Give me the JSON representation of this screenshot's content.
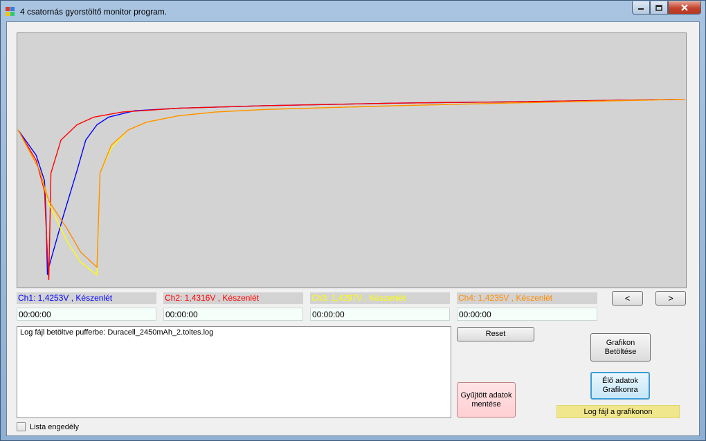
{
  "window": {
    "title": "4 csatornás gyorstöltő monitor program."
  },
  "channels": [
    {
      "label": "Ch1: 1,4253V , Készenlét",
      "time": "00:00:00",
      "color": "#0000ff"
    },
    {
      "label": "Ch2: 1,4316V , Készenlét",
      "time": "00:00:00",
      "color": "#ff0000"
    },
    {
      "label": "Ch3: 1,4297V , Készenlét",
      "time": "00:00:00",
      "color": "#ffff00"
    },
    {
      "label": "Ch4: 1,4235V , Készenlét",
      "time": "00:00:00",
      "color": "#ff8c00"
    }
  ],
  "nav": {
    "prev": "<",
    "next": ">"
  },
  "buttons": {
    "reset": "Reset",
    "save_collected": "Gyűjtött adatok mentése",
    "load_chart": "Grafikon Betöltése",
    "live_to_chart": "Élő adatok Grafikonra"
  },
  "log": {
    "text": "Log fájl betöltve pufferbe: Duracell_2450mAh_2.toltes.log"
  },
  "status": {
    "text": "Log fájl a grafikonon"
  },
  "list_enable": {
    "label": "Lista engedély",
    "checked": false
  },
  "chart_data": {
    "type": "line",
    "series": [
      {
        "color": "#0000ff",
        "points": [
          [
            0,
            0.62
          ],
          [
            0.3,
            0.52
          ],
          [
            0.55,
            0.42
          ],
          [
            0.6,
            0.29
          ],
          [
            0.65,
            0.05
          ],
          [
            0.7,
            0.08
          ],
          [
            1.3,
            0.28
          ],
          [
            2,
            0.46
          ],
          [
            2.5,
            0.58
          ],
          [
            3.2,
            0.64
          ],
          [
            4,
            0.67
          ],
          [
            6,
            0.695
          ],
          [
            10,
            0.705
          ],
          [
            20,
            0.715
          ],
          [
            40,
            0.725
          ],
          [
            60,
            0.73
          ],
          [
            100,
            0.74
          ]
        ]
      },
      {
        "color": "#ff0000",
        "points": [
          [
            0,
            0.62
          ],
          [
            0.3,
            0.5
          ],
          [
            0.55,
            0.38
          ],
          [
            0.6,
            0.25
          ],
          [
            0.7,
            0.03
          ],
          [
            0.78,
            0.45
          ],
          [
            1.2,
            0.58
          ],
          [
            2,
            0.64
          ],
          [
            3,
            0.67
          ],
          [
            5,
            0.69
          ],
          [
            10,
            0.705
          ],
          [
            20,
            0.715
          ],
          [
            40,
            0.725
          ],
          [
            60,
            0.73
          ],
          [
            100,
            0.74
          ]
        ]
      },
      {
        "color": "#ffff00",
        "points": [
          [
            0,
            0.62
          ],
          [
            0.4,
            0.46
          ],
          [
            0.7,
            0.33
          ],
          [
            1.5,
            0.18
          ],
          [
            2.2,
            0.1
          ],
          [
            3.2,
            0.05
          ],
          [
            3.4,
            0.45
          ],
          [
            4.2,
            0.55
          ],
          [
            5.5,
            0.62
          ],
          [
            7,
            0.65
          ],
          [
            10,
            0.675
          ],
          [
            14,
            0.69
          ],
          [
            20,
            0.7
          ],
          [
            40,
            0.715
          ],
          [
            60,
            0.725
          ],
          [
            100,
            0.74
          ]
        ]
      },
      {
        "color": "#ff8c00",
        "points": [
          [
            0,
            0.62
          ],
          [
            0.4,
            0.46
          ],
          [
            0.7,
            0.34
          ],
          [
            1.5,
            0.23
          ],
          [
            2.2,
            0.14
          ],
          [
            3.2,
            0.08
          ],
          [
            3.4,
            0.45
          ],
          [
            4.2,
            0.56
          ],
          [
            5.5,
            0.62
          ],
          [
            7,
            0.65
          ],
          [
            10,
            0.675
          ],
          [
            14,
            0.69
          ],
          [
            20,
            0.7
          ],
          [
            40,
            0.715
          ],
          [
            60,
            0.725
          ],
          [
            100,
            0.74
          ]
        ]
      }
    ]
  }
}
